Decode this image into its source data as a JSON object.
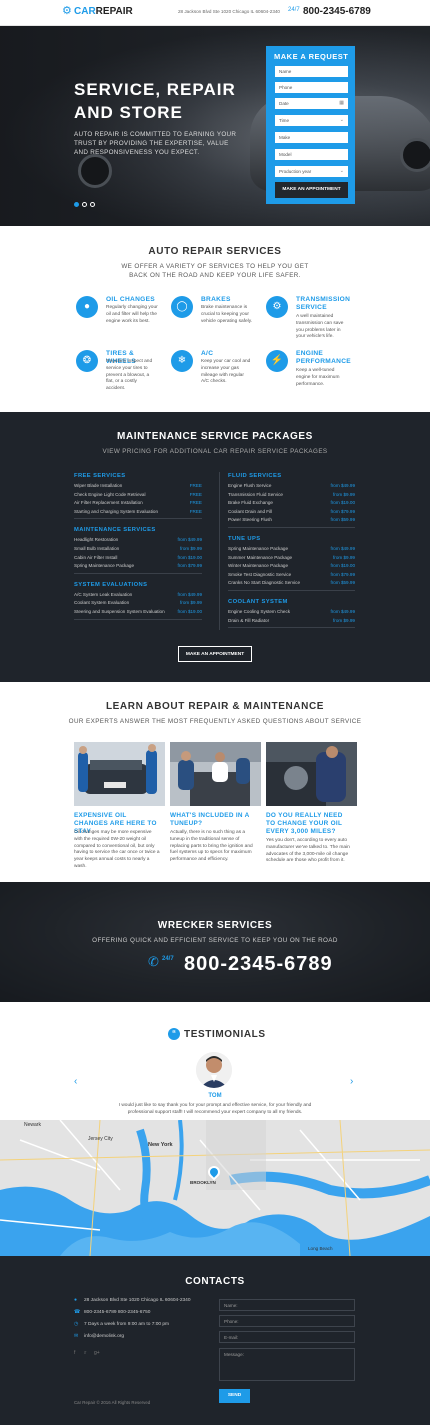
{
  "header": {
    "logo_a": "CAR",
    "logo_b": "REPAIR",
    "address": "28 Jackson Blvd Ste 1020 Chicago IL 60604-2340",
    "phone_label": "24/7",
    "phone": "800-2345-6789"
  },
  "hero": {
    "title": "SERVICE, REPAIR AND STORE",
    "text": "AUTO REPAIR IS COMMITTED TO EARNING YOUR TRUST BY PROVIDING THE EXPERTISE, VALUE AND RESPONSIVENESS YOU EXPECT.",
    "form": {
      "title": "MAKE A REQUEST",
      "name": "Name",
      "phone": "Phone",
      "date": "Date",
      "time": "Time",
      "make": "Make",
      "model": "Model",
      "year": "Production year",
      "button": "MAKE AN APPOINTMENT"
    }
  },
  "services": {
    "title": "AUTO REPAIR SERVICES",
    "subtitle": "WE OFFER A VARIETY OF SERVICES TO HELP YOU GET BACK ON THE ROAD AND KEEP YOUR LIFE SAFER.",
    "items": [
      {
        "title": "OIL CHANGES",
        "text": "Regularly changing your oil and filter will help the engine work its best.",
        "icon": "oil-can-icon"
      },
      {
        "title": "BRAKES",
        "text": "Brake maintenance is crucial to keeping your vehicle operating safely.",
        "icon": "brake-icon"
      },
      {
        "title": "TRANSMISSION SERVICE",
        "text": "A well maintained transmission can save you problems later in your vehicle's life.",
        "icon": "transmission-icon"
      },
      {
        "title": "TIRES & WHEELS",
        "text": "Regularly inspect and service your tires to prevent a blowout, a flat, or a costly accident.",
        "icon": "tire-icon"
      },
      {
        "title": "A/C",
        "text": "Keep your car cool and increase your gas mileage with regular A/C checks.",
        "icon": "ac-icon"
      },
      {
        "title": "ENGINE PERFORMANCE",
        "text": "Keep a well-tuned engine for maximum performance.",
        "icon": "engine-icon"
      }
    ]
  },
  "maintenance": {
    "title": "MAINTENANCE SERVICE PACKAGES",
    "subtitle": "VIEW PRICING FOR ADDITIONAL CAR REPAIR SERVICE PACKAGES",
    "button": "MAKE AN APPOINTMENT",
    "left": [
      {
        "head": "FREE SERVICES",
        "rows": [
          [
            "Wiper Blade Installation",
            "FREE"
          ],
          [
            "Check Engine Light Code Retrieval",
            "FREE"
          ],
          [
            "Air Filter Replacement Installation",
            "FREE"
          ],
          [
            "Starting and Charging System Evaluation",
            "FREE"
          ]
        ]
      },
      {
        "head": "MAINTENANCE SERVICES",
        "rows": [
          [
            "Headlight Restoration",
            "from $49.99"
          ],
          [
            "Small Bulb Installation",
            "from $9.99"
          ],
          [
            "Cabin Air Filter Install",
            "from $19.00"
          ],
          [
            "Spring Maintenance Package",
            "from $79.99"
          ]
        ]
      },
      {
        "head": "SYSTEM EVALUATIONS",
        "rows": [
          [
            "A/C System Leak Evaluation",
            "from $49.99"
          ],
          [
            "Coolant System Evaluation",
            "from $9.99"
          ],
          [
            "Steering and Suspension System Evaluation",
            "from $19.00"
          ]
        ]
      }
    ],
    "right": [
      {
        "head": "FLUID SERVICES",
        "rows": [
          [
            "Engine Flush Service",
            "from $49.99"
          ],
          [
            "Transmission Fluid Service",
            "from $9.99"
          ],
          [
            "Brake Fluid Exchange",
            "from $19.00"
          ],
          [
            "Coolant Drain and Fill",
            "from $79.99"
          ],
          [
            "Power Steering Flush",
            "from $59.99"
          ]
        ]
      },
      {
        "head": "TUNE UPS",
        "rows": [
          [
            "Spring Maintenance Package",
            "from $49.99"
          ],
          [
            "Summer Maintenance Package",
            "from $9.99"
          ],
          [
            "Winter Maintenance Package",
            "from $19.00"
          ],
          [
            "Smoke Test Diagnostic Service",
            "from $79.99"
          ],
          [
            "Cranks No Start Diagnostic Service",
            "from $59.99"
          ]
        ]
      },
      {
        "head": "COOLANT SYSTEM",
        "rows": [
          [
            "Engine Cooling System Check",
            "from $49.99"
          ],
          [
            "Drain & Fill Radiator",
            "from $9.99"
          ]
        ]
      }
    ]
  },
  "learn": {
    "title": "LEARN ABOUT REPAIR & MAINTENANCE",
    "subtitle": "OUR EXPERTS ANSWER THE MOST FREQUENTLY ASKED QUESTIONS ABOUT SERVICE",
    "articles": [
      {
        "title": "EXPENSIVE OIL CHANGES ARE HERE TO STAY",
        "text": "Oil changes may be more expensive with the required 0W-20 weight oil compared to conventional oil, but only having to service the car once or twice a year keeps annual costs to nearly a wash."
      },
      {
        "title": "WHAT'S INCLUDED IN A TUNEUP?",
        "text": "Actually, there is no such thing as a tuneup in the traditional sense of replacing parts to bring the ignition and fuel systems up to specs for maximum performance and efficiency."
      },
      {
        "title": "DO YOU REALLY NEED TO CHANGE YOUR OIL EVERY 3,000 MILES?",
        "text": "Yes you don't, according to every auto manufacturer we've talked to. The main advocates of the 3,000-mile oil change schedule are those who profit from it."
      }
    ]
  },
  "wrecker": {
    "title": "WRECKER SERVICES",
    "subtitle": "OFFERING QUICK AND EFFICIENT SERVICE TO KEEP YOU ON THE ROAD",
    "label": "24/7",
    "phone": "800-2345-6789"
  },
  "testimonials": {
    "title": "TESTIMONIALS",
    "name": "TOM",
    "quote": "I would just like to say thank you for your prompt and effective service, for your friendly and professional support staff! I will recommend your expert company to all my friends."
  },
  "map": {
    "labels": [
      "Newark",
      "Jersey City",
      "New York",
      "BROOKLYN",
      "Long Beach"
    ]
  },
  "contacts": {
    "title": "CONTACTS",
    "address": "28 Jackson Blvd Ste 1020 Chicago IL 60604-2340",
    "phones": "800-2345-6789   800-2345-6750",
    "hours": "7 Days a week from 9:00 am to 7:00 pm",
    "email": "info@demolink.org",
    "form": {
      "name": "Name:",
      "phone": "Phone:",
      "email": "E-mail:",
      "message": "Message:",
      "button": "SEND"
    },
    "copyright": "Car Repair © 2016 All Rights Reserved"
  }
}
